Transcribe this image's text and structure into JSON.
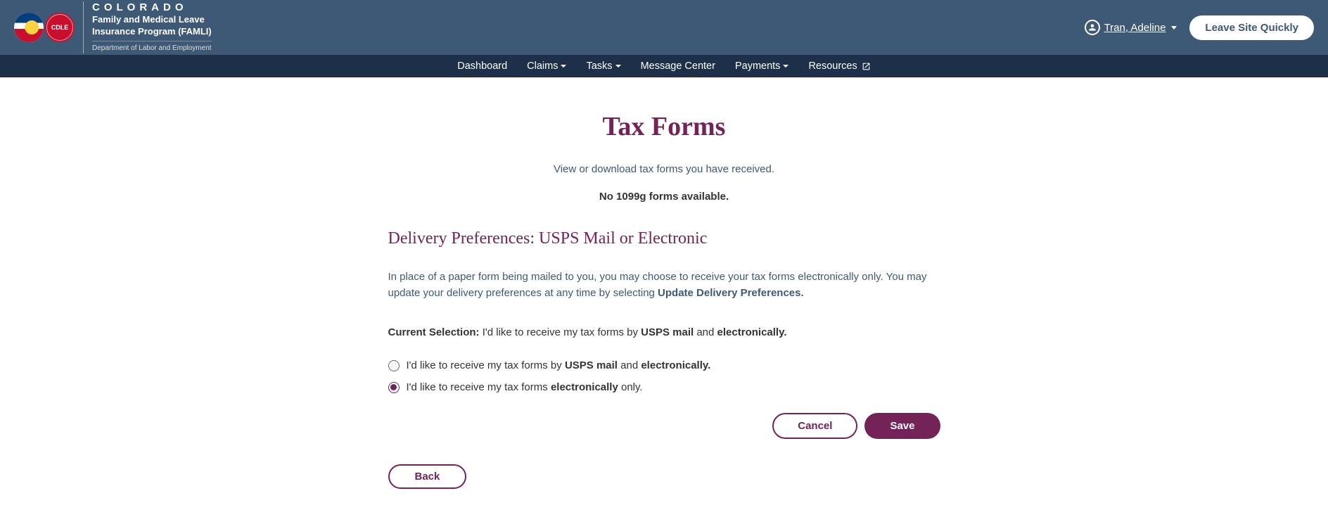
{
  "header": {
    "brand_title": "COLORADO",
    "brand_sub1": "Family and Medical Leave",
    "brand_sub2": "Insurance Program (FAMLI)",
    "brand_dept": "Department of Labor and Employment",
    "user_name": "Tran, Adeline",
    "leave_label": "Leave Site Quickly"
  },
  "nav": {
    "dashboard": "Dashboard",
    "claims": "Claims",
    "tasks": "Tasks",
    "message_center": "Message Center",
    "payments": "Payments",
    "resources": "Resources"
  },
  "page": {
    "title": "Tax Forms",
    "subtitle": "View or download tax forms you have received.",
    "no_forms": "No 1099g forms available.",
    "section_heading": "Delivery Preferences: USPS Mail or Electronic",
    "info_pre": "In place of a paper form being mailed to you, you may choose to receive your tax forms electronically only. You may update your delivery preferences at any time by selecting ",
    "info_strong": "Update Delivery Preferences.",
    "current_label": "Current Selection:",
    "current_pre": " I'd like to receive my tax forms by ",
    "current_b1": "USPS mail",
    "current_mid": " and ",
    "current_b2": "electronically.",
    "opt1_pre": "I'd like to receive my tax forms by ",
    "opt1_b1": "USPS mail",
    "opt1_mid": " and ",
    "opt1_b2": "electronically.",
    "opt2_pre": "I'd like to receive my tax forms ",
    "opt2_b1": "electronically",
    "opt2_post": " only.",
    "cancel": "Cancel",
    "save": "Save",
    "back": "Back",
    "selected_option": "electronic"
  }
}
